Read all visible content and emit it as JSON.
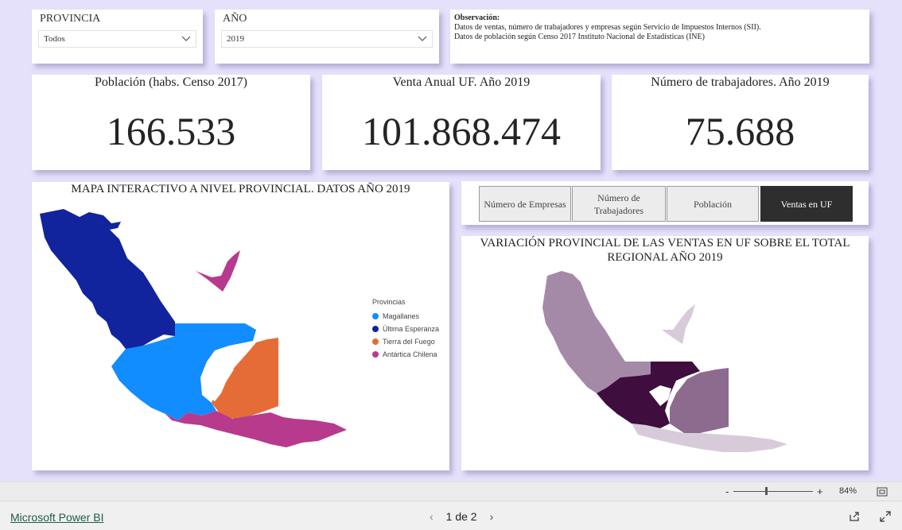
{
  "filters": {
    "provincia": {
      "label": "PROVINCIA",
      "value": "Todos"
    },
    "anio": {
      "label": "AÑO",
      "value": "2019"
    }
  },
  "observacion": {
    "title": "Observación:",
    "line1": "Datos de ventas, número de trabajadores y empresas según Servicio de Impuestos Internos (SII).",
    "line2": "Datos de población según Censo 2017 Instituto Nacional de Estadísticas (INE)"
  },
  "kpis": [
    {
      "title": "Población (habs. Censo 2017)",
      "value": "166.533"
    },
    {
      "title": "Venta Anual UF. Año 2019",
      "value": "101.868.474"
    },
    {
      "title": "Número de trabajadores. Año 2019",
      "value": "75.688"
    }
  ],
  "map": {
    "title": "MAPA INTERACTIVO A NIVEL PROVINCIAL. DATOS AÑO 2019",
    "legend_title": "Provincias",
    "legend": [
      {
        "name": "Magallanes",
        "color": "#118dff"
      },
      {
        "name": "Última Esperanza",
        "color": "#12239e"
      },
      {
        "name": "Tierra del Fuego",
        "color": "#e66c37"
      },
      {
        "name": "Antártica Chilena",
        "color": "#b73a8c"
      }
    ]
  },
  "buttons": [
    {
      "label": "Número de Empresas",
      "active": false
    },
    {
      "label": "Número de Trabajadores",
      "active": false
    },
    {
      "label": "Población",
      "active": false
    },
    {
      "label": "Ventas en UF",
      "active": true
    }
  ],
  "variation": {
    "title": "VARIACIÓN PROVINCIAL DE LAS VENTAS EN UF SOBRE EL TOTAL REGIONAL AÑO 2019",
    "colors": {
      "magallanes": "#3f0d3e",
      "ultima": "#a58aa8",
      "tierra": "#8c6b8e",
      "antartica": "#d8cbd9"
    }
  },
  "zoom": {
    "minus": "-",
    "plus": "+",
    "value": "84%"
  },
  "footer": {
    "brand": "Microsoft Power BI",
    "page": "1 de 2"
  }
}
